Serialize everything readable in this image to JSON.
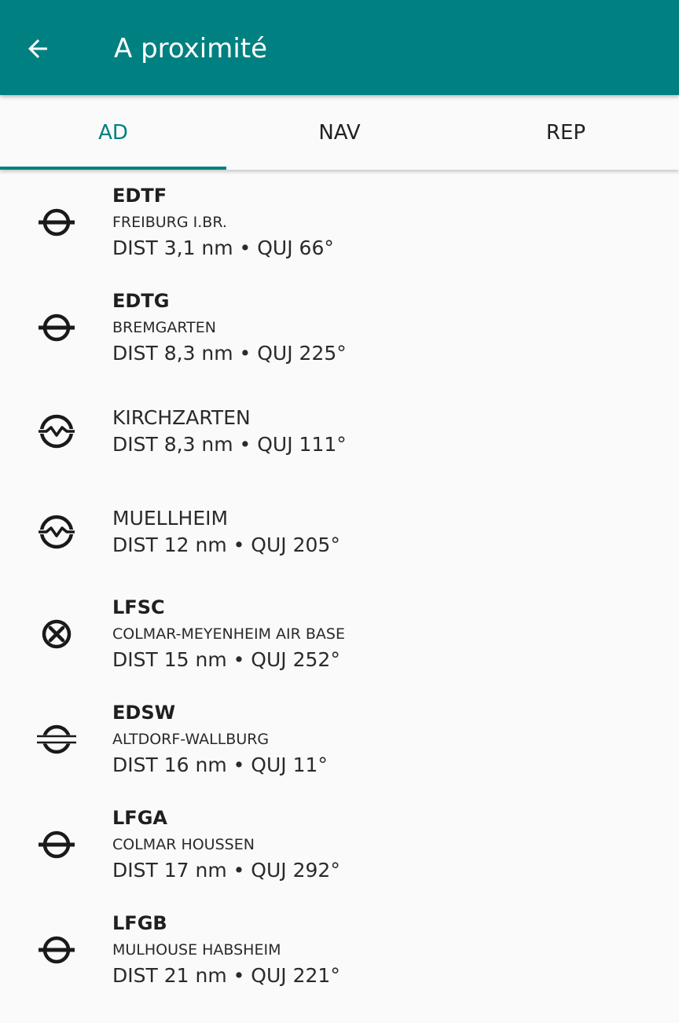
{
  "appbar": {
    "title": "A proximité",
    "back_icon": "arrow-left-icon"
  },
  "tabs": [
    {
      "label": "AD",
      "selected": true
    },
    {
      "label": "NAV",
      "selected": false
    },
    {
      "label": "REP",
      "selected": false
    }
  ],
  "colors": {
    "primary": "#008080",
    "background": "#fafafa",
    "text": "#1f1f1f"
  },
  "items": [
    {
      "code": "EDTF",
      "name": "FREIBURG I.BR.",
      "dist": "DIST 3,1 nm • QUJ 66°",
      "icon": "aerodrome-icon"
    },
    {
      "code": "EDTG",
      "name": "BREMGARTEN",
      "dist": "DIST 8,3 nm • QUJ 225°",
      "icon": "aerodrome-icon"
    },
    {
      "code": "",
      "name": "KIRCHZARTEN",
      "dist": "DIST 8,3 nm • QUJ 111°",
      "icon": "glider-site-icon"
    },
    {
      "code": "",
      "name": "MUELLHEIM",
      "dist": "DIST 12 nm • QUJ 205°",
      "icon": "glider-site-icon"
    },
    {
      "code": "LFSC",
      "name": "COLMAR-MEYENHEIM AIR BASE",
      "dist": "DIST 15 nm • QUJ 252°",
      "icon": "military-aerodrome-icon"
    },
    {
      "code": "EDSW",
      "name": "ALTDORF-WALLBURG",
      "dist": "DIST 16 nm • QUJ 11°",
      "icon": "ultralight-aerodrome-icon"
    },
    {
      "code": "LFGA",
      "name": "COLMAR HOUSSEN",
      "dist": "DIST 17 nm • QUJ 292°",
      "icon": "aerodrome-icon"
    },
    {
      "code": "LFGB",
      "name": "MULHOUSE HABSHEIM",
      "dist": "DIST 21 nm • QUJ 221°",
      "icon": "aerodrome-icon"
    }
  ]
}
